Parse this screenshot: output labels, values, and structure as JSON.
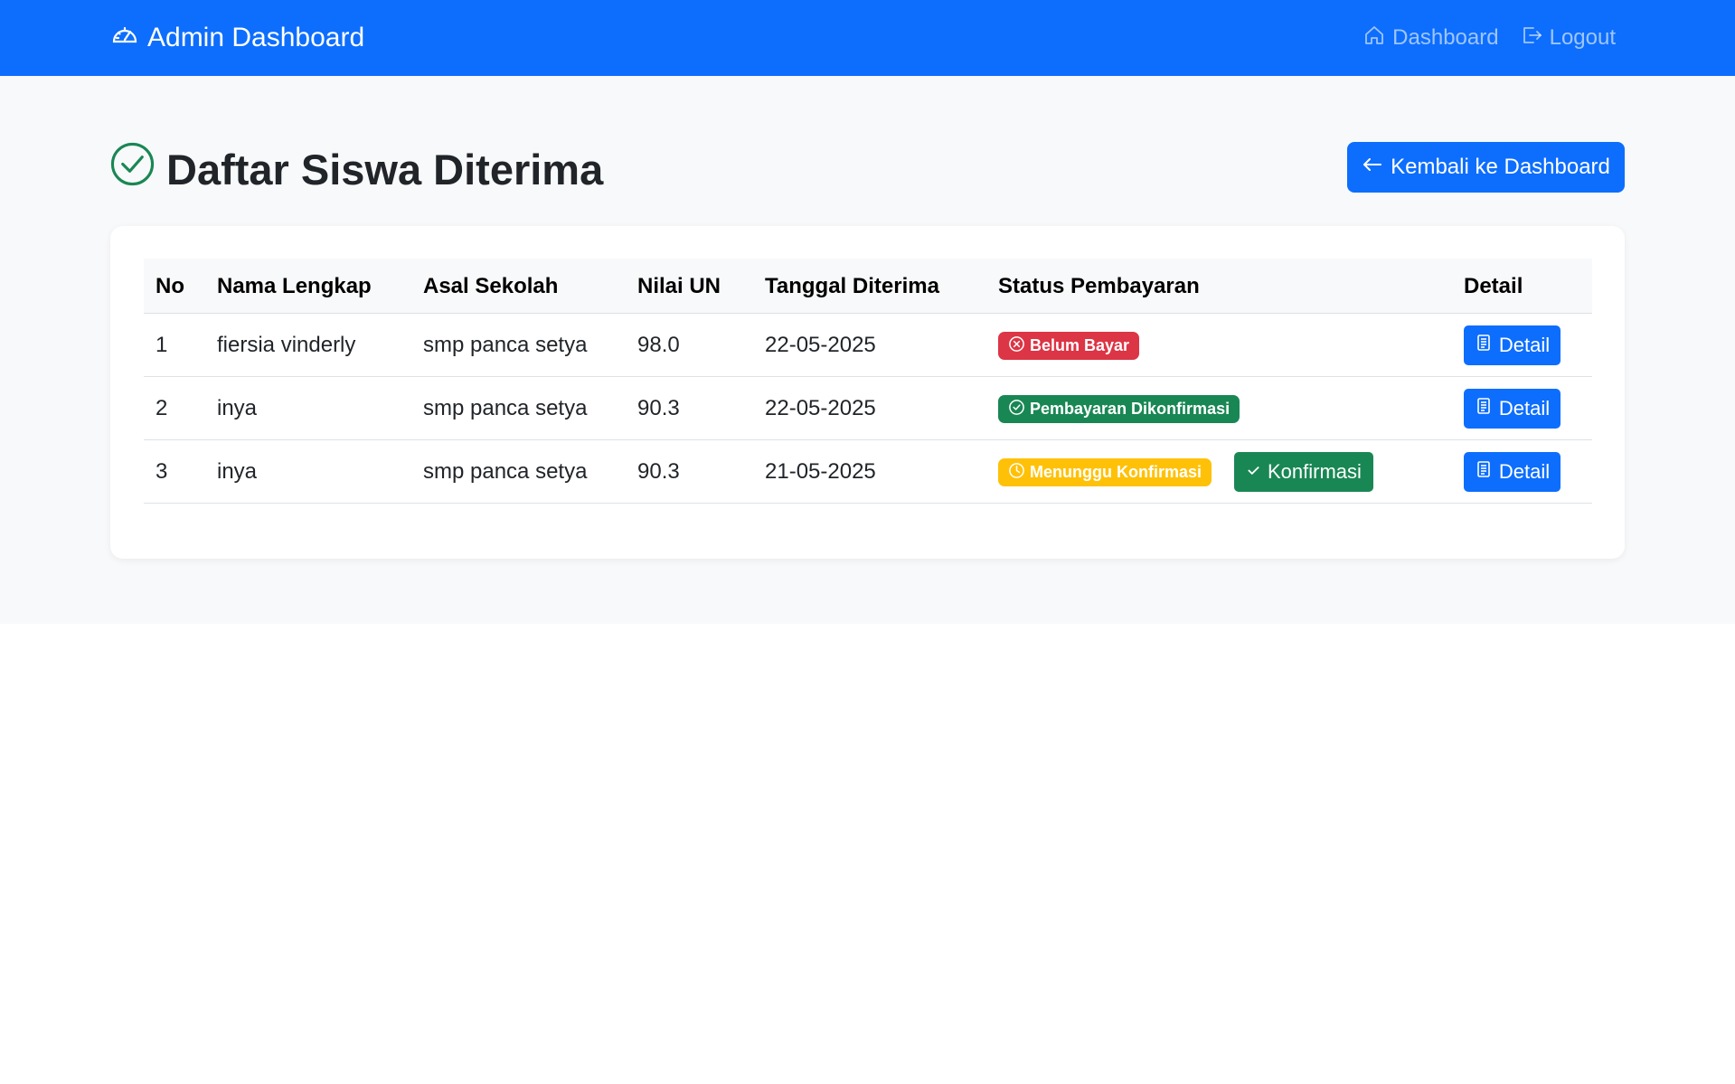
{
  "navbar": {
    "brand": "Admin Dashboard",
    "brand_icon": "speedometer-icon",
    "links": [
      {
        "label": "Dashboard",
        "icon": "house-icon"
      },
      {
        "label": "Logout",
        "icon": "logout-icon"
      }
    ],
    "color": "#0d6efd"
  },
  "page": {
    "title": "Daftar Siswa Diterima",
    "title_icon": "check-circle-icon",
    "back_button": "Kembali ke Dashboard"
  },
  "table": {
    "headers": {
      "no": "No",
      "nama": "Nama Lengkap",
      "sekolah": "Asal Sekolah",
      "nilai": "Nilai UN",
      "tanggal": "Tanggal Diterima",
      "status": "Status Pembayaran",
      "detail": "Detail"
    },
    "rows": [
      {
        "no": "1",
        "nama": "fiersia vinderly",
        "sekolah": "smp panca setya",
        "nilai": "98.0",
        "tanggal": "22-05-2025",
        "status": "Belum Bayar",
        "status_color": "#dc3545",
        "detail": "Detail"
      },
      {
        "no": "2",
        "nama": "inya",
        "sekolah": "smp panca setya",
        "nilai": "90.3",
        "tanggal": "22-05-2025",
        "status": "Pembayaran Dikonfirmasi",
        "status_color": "#198754",
        "detail": "Detail"
      },
      {
        "no": "3",
        "nama": "inya",
        "sekolah": "smp panca setya",
        "nilai": "90.3",
        "tanggal": "21-05-2025",
        "status": "Menunggu Konfirmasi",
        "status_color": "#ffc107",
        "confirm_button": "Konfirmasi",
        "detail": "Detail"
      }
    ]
  }
}
